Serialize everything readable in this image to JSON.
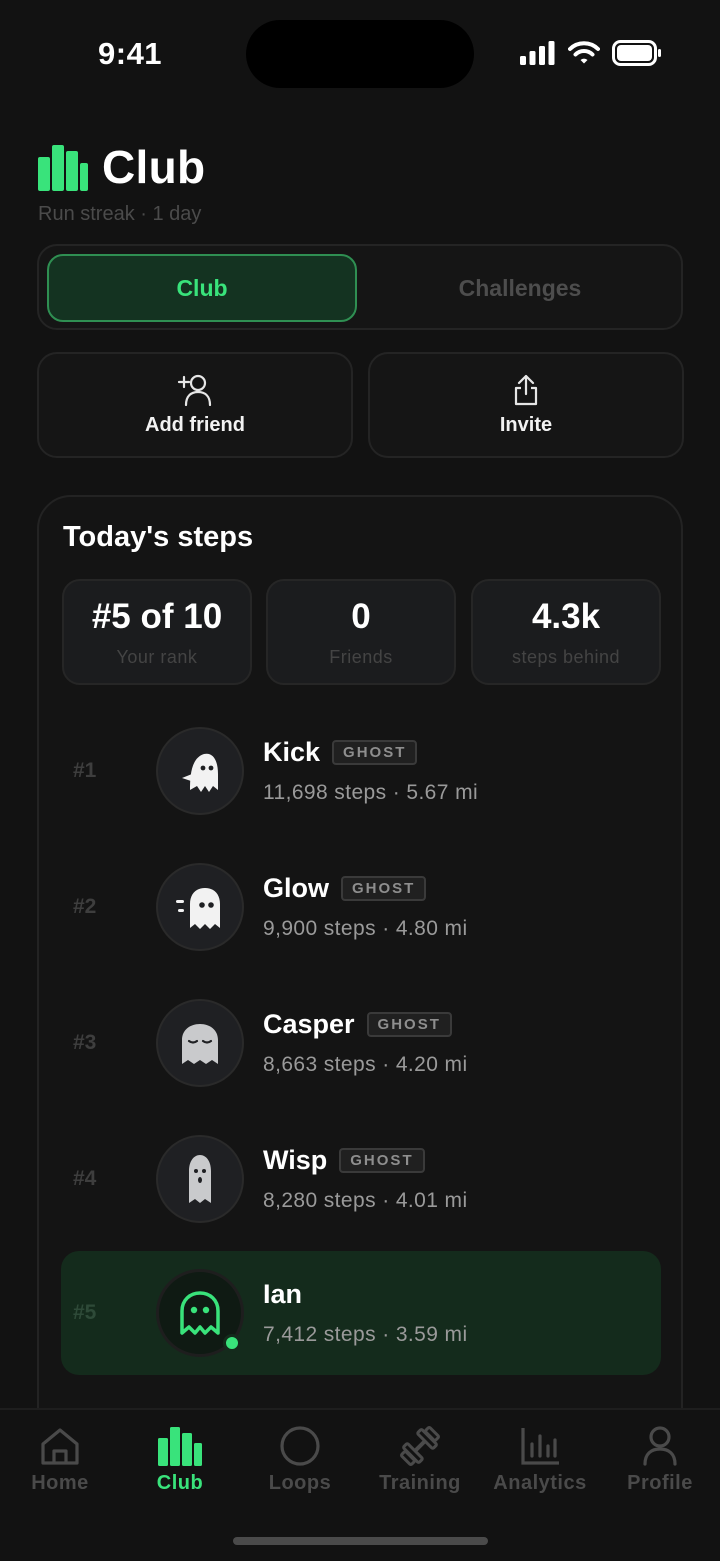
{
  "status_bar": {
    "time": "9:41"
  },
  "header": {
    "title": "Club",
    "subtitle": "Run streak · 1 day",
    "icon": "bar-chart-icon"
  },
  "tabs": [
    {
      "label": "Club",
      "active": true
    },
    {
      "label": "Challenges",
      "active": false
    }
  ],
  "actions": {
    "add_friend": {
      "label": "Add friend",
      "icon": "add-user-icon"
    },
    "invite": {
      "label": "Invite",
      "icon": "share-icon"
    }
  },
  "steps_card": {
    "title": "Today's steps",
    "stats": [
      {
        "value": "#5 of 10",
        "label": "Your rank"
      },
      {
        "value": "0",
        "label": "Friends"
      },
      {
        "value": "4.3k",
        "label": "steps behind"
      }
    ],
    "leaderboard": [
      {
        "rank": "#1",
        "name": "Kick",
        "badge": "GHOST",
        "detail": "11,698 steps · 5.67 mi",
        "icon": "ghost-kick-icon"
      },
      {
        "rank": "#2",
        "name": "Glow",
        "badge": "GHOST",
        "detail": "9,900 steps · 4.80 mi",
        "icon": "ghost-dash-icon"
      },
      {
        "rank": "#3",
        "name": "Casper",
        "badge": "GHOST",
        "detail": "8,663 steps · 4.20 mi",
        "icon": "ghost-sleepy-icon"
      },
      {
        "rank": "#4",
        "name": "Wisp",
        "badge": "GHOST",
        "detail": "8,280 steps · 4.01 mi",
        "icon": "ghost-wisp-icon"
      },
      {
        "rank": "#5",
        "name": "Ian",
        "badge": "",
        "detail": "7,412 steps · 3.59 mi",
        "icon": "ghost-outline-icon",
        "is_me": true
      }
    ]
  },
  "bottom_nav": [
    {
      "label": "Home",
      "icon": "home-icon"
    },
    {
      "label": "Club",
      "icon": "bar-chart-icon",
      "active": true
    },
    {
      "label": "Loops",
      "icon": "circle-icon"
    },
    {
      "label": "Training",
      "icon": "dumbbell-icon"
    },
    {
      "label": "Analytics",
      "icon": "analytics-icon"
    },
    {
      "label": "Profile",
      "icon": "user-icon"
    }
  ],
  "colors": {
    "accent": "#39e37b",
    "background": "#121212",
    "card": "#141414",
    "highlight_row": "#142b1c"
  }
}
